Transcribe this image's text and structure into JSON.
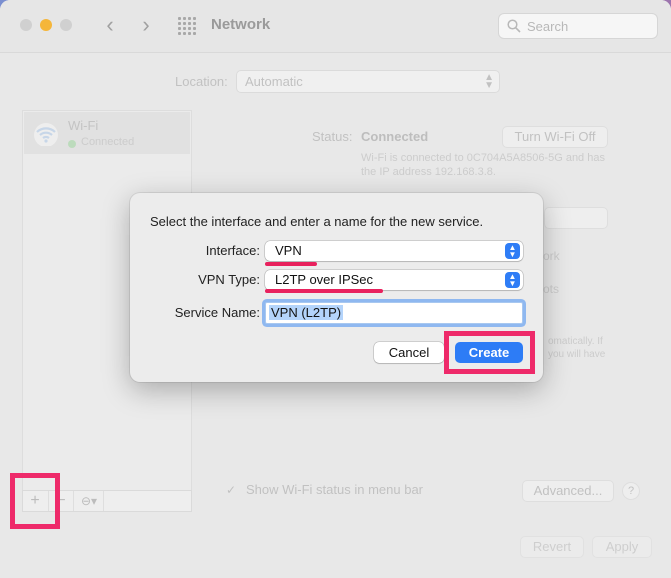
{
  "window": {
    "title": "Network",
    "search_placeholder": "Search",
    "nav_back": "‹",
    "nav_forward": "›"
  },
  "location": {
    "label": "Location:",
    "value": "Automatic"
  },
  "sidebar": {
    "items": [
      {
        "name": "Wi-Fi",
        "status": "Connected",
        "status_color": "#a8d8a8"
      }
    ],
    "toolbar": {
      "add": "+",
      "remove": "−",
      "action": "⊖▾"
    }
  },
  "details": {
    "status_label": "Status:",
    "status_value": "Connected",
    "turn_off_label": "Turn Wi-Fi Off",
    "description": "Wi-Fi is connected to 0C704A5A8506-5G and has the IP address 192.168.3.8.",
    "fragments": [
      "ork",
      "ots",
      "omatically. If",
      "you will have"
    ],
    "show_wifi_label": "Show Wi-Fi status in menu bar",
    "advanced_label": "Advanced...",
    "help_label": "?",
    "revert_label": "Revert",
    "apply_label": "Apply"
  },
  "dialog": {
    "message": "Select the interface and enter a name for the new service.",
    "interface_label": "Interface:",
    "interface_value": "VPN",
    "vpn_type_label": "VPN Type:",
    "vpn_type_value": "L2TP over IPSec",
    "service_name_label": "Service Name:",
    "service_name_value": "VPN (L2TP)",
    "cancel_label": "Cancel",
    "create_label": "Create"
  },
  "colors": {
    "accent": "#2d7cf6",
    "annotation": "#ee2a6a",
    "traffic_minimize": "#f5b63a"
  }
}
